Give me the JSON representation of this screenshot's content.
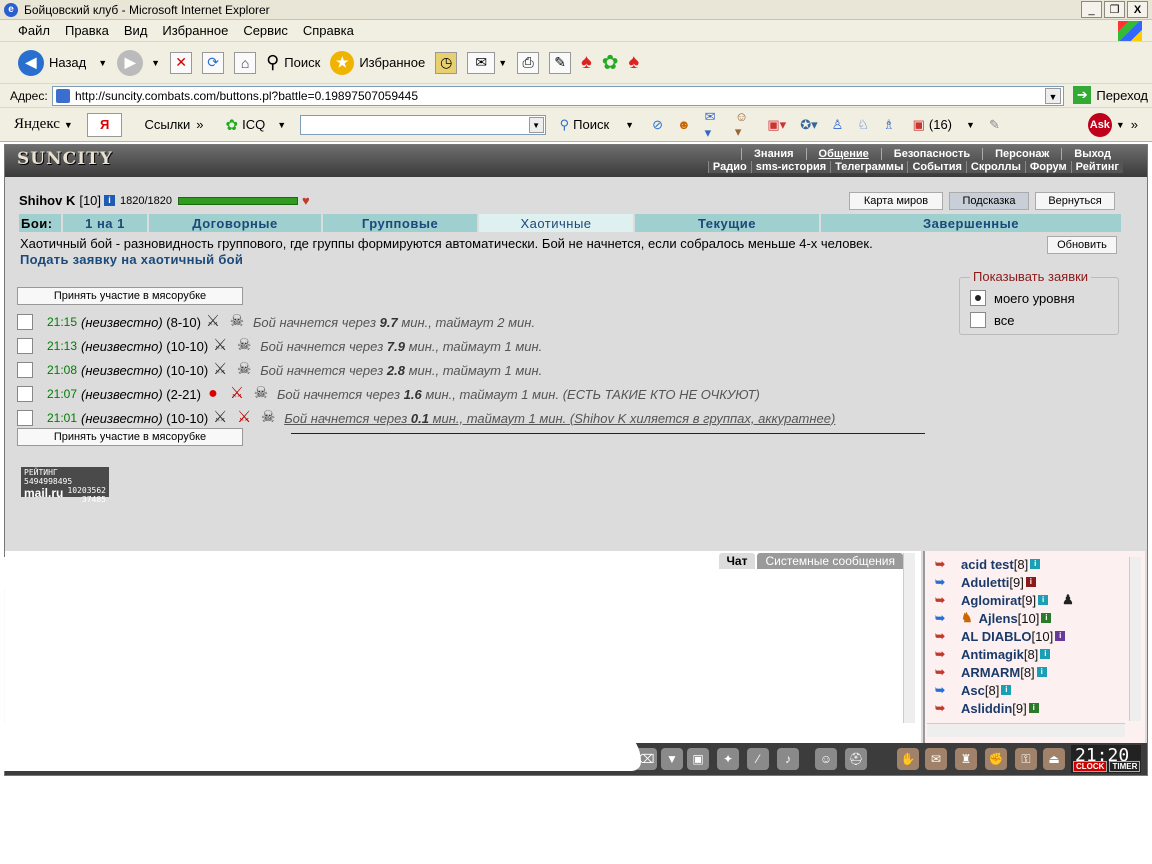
{
  "window": {
    "title": "Бойцовский клуб - Microsoft Internet Explorer",
    "min": "_",
    "max": "❐",
    "close": "X"
  },
  "menu": [
    "Файл",
    "Правка",
    "Вид",
    "Избранное",
    "Сервис",
    "Справка"
  ],
  "toolbar": {
    "back": "Назад",
    "search": "Поиск",
    "favorites": "Избранное"
  },
  "address": {
    "label": "Адрес:",
    "url": "http://suncity.combats.com/buttons.pl?battle=0.19897507059445",
    "go": "Переход"
  },
  "yandex": {
    "logo": "Яндекс",
    "ya": "Я",
    "links": "Ссылки",
    "icq": "ICQ",
    "search": "Поиск",
    "count": "(16)"
  },
  "game": {
    "logo": "SUNCITY",
    "nav_top": [
      "Знания",
      "Общение",
      "Безопасность",
      "Персонаж",
      "Выход"
    ],
    "nav_bottom": [
      "Радио",
      "sms-история",
      "Телеграммы",
      "События",
      "Скроллы",
      "Форум",
      "Рейтинг"
    ],
    "hero": {
      "name": "Shihov K",
      "level": "[10]",
      "hp": "1820/1820",
      "hp_fraction": 1.0
    },
    "buttons": {
      "map": "Карта миров",
      "hint": "Подсказка",
      "back": "Вернуться",
      "refresh": "Обновить"
    },
    "tabs": {
      "label": "Бои:",
      "items": [
        "1 на 1",
        "Договорные",
        "Групповые",
        "Хаотичные",
        "Текущие",
        "Завершенные"
      ],
      "selected": "Хаотичные"
    },
    "description": "Хаотичный бой - разновидность группового, где группы формируются автоматически. Бой не начнется, если собралось меньше 4-х человек.",
    "request_link": "Подать заявку на хаотичный бой",
    "join_button": "Принять участие в мясорубке",
    "show_filter": {
      "legend": "Показывать заявки",
      "options": [
        "моего уровня",
        "все"
      ],
      "selected": "моего уровня"
    },
    "battles": [
      {
        "time": "21:15",
        "who": "(неизвестно)",
        "range": "(8-10)",
        "note_prefix": "Бой начнется через",
        "minutes": "9.7",
        "note_suffix": "мин., таймаут 2 мин.",
        "comment": ""
      },
      {
        "time": "21:13",
        "who": "(неизвестно)",
        "range": "(10-10)",
        "note_prefix": "Бой начнется через",
        "minutes": "7.9",
        "note_suffix": "мин., таймаут 1 мин.",
        "comment": ""
      },
      {
        "time": "21:08",
        "who": "(неизвестно)",
        "range": "(10-10)",
        "note_prefix": "Бой начнется через",
        "minutes": "2.8",
        "note_suffix": "мин., таймаут 1 мин.",
        "comment": ""
      },
      {
        "time": "21:07",
        "who": "(неизвестно)",
        "range": "(2-21)",
        "note_prefix": "Бой начнется через",
        "minutes": "1.6",
        "note_suffix": "мин., таймаут 1 мин.",
        "comment": "(ЕСТЬ ТАКИЕ КТО НЕ ОЧКУЮТ)"
      },
      {
        "time": "21:01",
        "who": "(неизвестно)",
        "range": "(10-10)",
        "note_prefix": "Бой начнется через",
        "minutes": "0.1",
        "note_suffix": "мин., таймаут 1 мин.",
        "comment": "(Shihov K хиляется в группах, аккуратнее)"
      }
    ],
    "counter": {
      "label": "РЕЙТИНГ",
      "value1": "5494998495",
      "value2": "10203562",
      "value3": "37485",
      "brand": "mail.ru"
    },
    "chat_tabs": [
      "Чат",
      "Системные сообщения"
    ],
    "users": [
      {
        "name": "acid test",
        "level": "[8]"
      },
      {
        "name": "Aduletti",
        "level": "[9]"
      },
      {
        "name": "Aglomirat",
        "level": "[9]"
      },
      {
        "name": "Ajlens",
        "level": "[10]"
      },
      {
        "name": "AL DIABLO",
        "level": "[10]"
      },
      {
        "name": "Antimagik",
        "level": "[8]"
      },
      {
        "name": "ARMARM",
        "level": "[8]"
      },
      {
        "name": "Asc",
        "level": "[8]"
      },
      {
        "name": "Asliddin",
        "level": "[9]"
      }
    ],
    "clock": {
      "time": "21:20",
      "clock_label": "CLOCK",
      "timer_label": "TIMER"
    }
  },
  "colors": {
    "hp": "#2f9c20",
    "tab": "#9fcfcf",
    "time": "#007c00",
    "link": "#1a4a7a"
  }
}
